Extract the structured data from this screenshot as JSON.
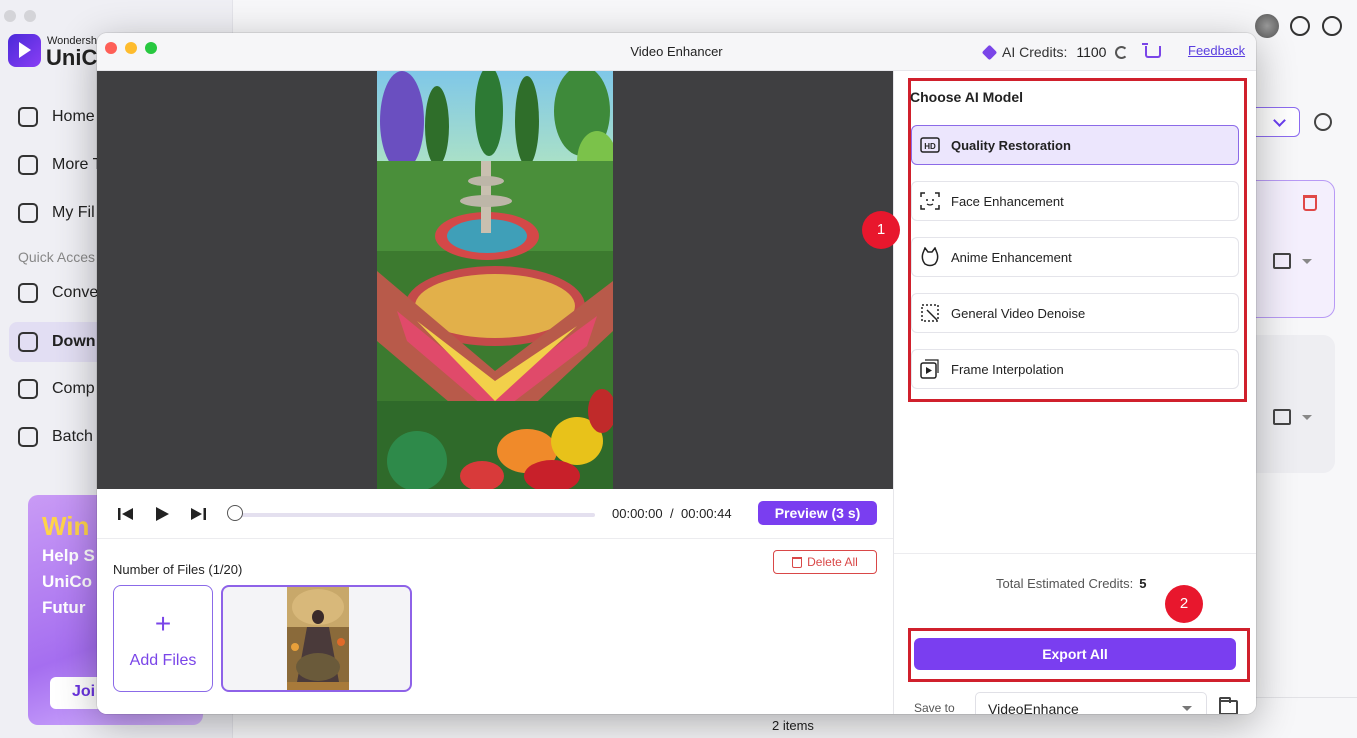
{
  "app": {
    "brand_small": "Wondersh",
    "brand_big": "UniCo",
    "nav": [
      {
        "label": "Home",
        "icon": "home-icon"
      },
      {
        "label": "More T",
        "icon": "toolbox-icon"
      },
      {
        "label": "My Fil",
        "icon": "file-icon"
      },
      {
        "label": "Conve",
        "icon": "convert-icon"
      },
      {
        "label": "Down",
        "icon": "download-icon"
      },
      {
        "label": "Comp",
        "icon": "compress-icon"
      },
      {
        "label": "Batch",
        "icon": "batch-icon"
      }
    ],
    "quick_access": "Quick Acces",
    "promo": {
      "headline": "Win",
      "body": "Help S UniCo Futur",
      "button": "Joi"
    },
    "items_count": "2 items"
  },
  "modal": {
    "title": "Video Enhancer",
    "credits_label": "AI Credits:",
    "credits_value": "1100",
    "feedback": "Feedback"
  },
  "player": {
    "current_time": "00:00:00",
    "separator": "/",
    "total_time": "00:00:44",
    "preview_button": "Preview (3 s)",
    "progress": 0
  },
  "files": {
    "count_label": "Number of Files (1/20)",
    "delete_all": "Delete All",
    "add_files": "Add Files",
    "add_plus": "+"
  },
  "models": {
    "heading": "Choose AI Model",
    "items": [
      {
        "label": "Quality Restoration",
        "icon": "hd-icon",
        "selected": true
      },
      {
        "label": "Face Enhancement",
        "icon": "face-scan-icon",
        "selected": false
      },
      {
        "label": "Anime Enhancement",
        "icon": "anime-face-icon",
        "selected": false
      },
      {
        "label": "General Video Denoise",
        "icon": "denoise-icon",
        "selected": false
      },
      {
        "label": "Frame Interpolation",
        "icon": "frame-interpolation-icon",
        "selected": false
      }
    ]
  },
  "export": {
    "total_label": "Total Estimated Credits:",
    "total_value": "5",
    "export_button": "Export All",
    "save_to_label": "Save to",
    "save_to_value": "VideoEnhance"
  },
  "annotations": {
    "badge_1": "1",
    "badge_2": "2",
    "color": "#d0202c"
  },
  "colors": {
    "accent": "#7a3ef0",
    "danger": "#d94848"
  }
}
